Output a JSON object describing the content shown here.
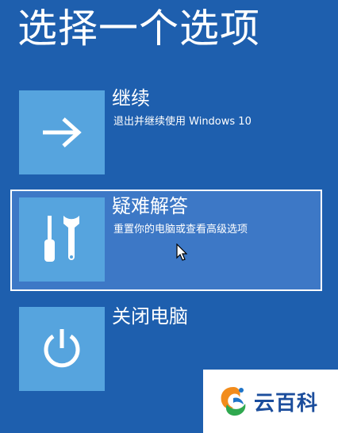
{
  "page": {
    "title": "选择一个选项"
  },
  "options": [
    {
      "heading": "继续",
      "description": "退出并继续使用 Windows 10",
      "icon": "arrow-right-icon"
    },
    {
      "heading": "疑难解答",
      "description": "重置你的电脑或查看高级选项",
      "icon": "tools-icon",
      "selected": true
    },
    {
      "heading": "关闭电脑",
      "description": "",
      "icon": "power-icon"
    }
  ],
  "watermark": {
    "text": "云百科",
    "icon": "yunbaike-logo-icon"
  },
  "colors": {
    "background": "#1e5fae",
    "tile": "#56a4de",
    "selected_option": "#3d78c6",
    "watermark_text": "#1b4d9c"
  }
}
